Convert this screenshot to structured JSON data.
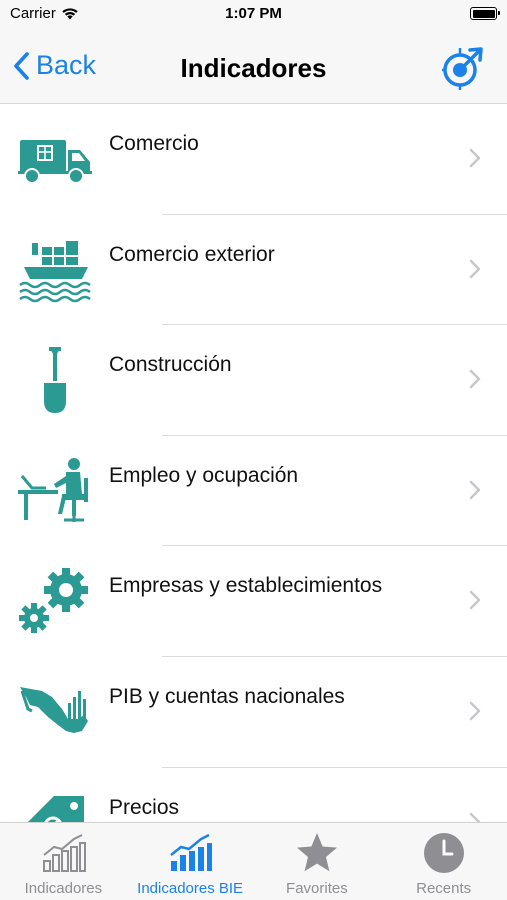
{
  "status_bar": {
    "carrier": "Carrier",
    "time": "1:07 PM"
  },
  "nav": {
    "back_label": "Back",
    "title": "Indicadores"
  },
  "colors": {
    "accent": "#1a82e8",
    "icon_teal": "#2b9a92",
    "tab_inactive": "#8e8e93"
  },
  "list": {
    "items": [
      {
        "label": "Comercio",
        "icon": "delivery-truck-icon"
      },
      {
        "label": "Comercio exterior",
        "icon": "cargo-ship-icon"
      },
      {
        "label": "Construcción",
        "icon": "shovel-icon"
      },
      {
        "label": "Empleo y ocupación",
        "icon": "worker-at-desk-icon"
      },
      {
        "label": "Empresas y establecimientos",
        "icon": "gears-icon"
      },
      {
        "label": "PIB y cuentas nacionales",
        "icon": "mexico-map-chart-icon"
      },
      {
        "label": "Precios",
        "icon": "price-tag-icon"
      }
    ]
  },
  "tab_bar": {
    "tabs": [
      {
        "label": "Indicadores",
        "icon": "bar-chart-outline-icon",
        "active": false
      },
      {
        "label": "Indicadores BIE",
        "icon": "bar-chart-filled-icon",
        "active": true
      },
      {
        "label": "Favorites",
        "icon": "star-icon",
        "active": false
      },
      {
        "label": "Recents",
        "icon": "clock-icon",
        "active": false
      }
    ]
  }
}
